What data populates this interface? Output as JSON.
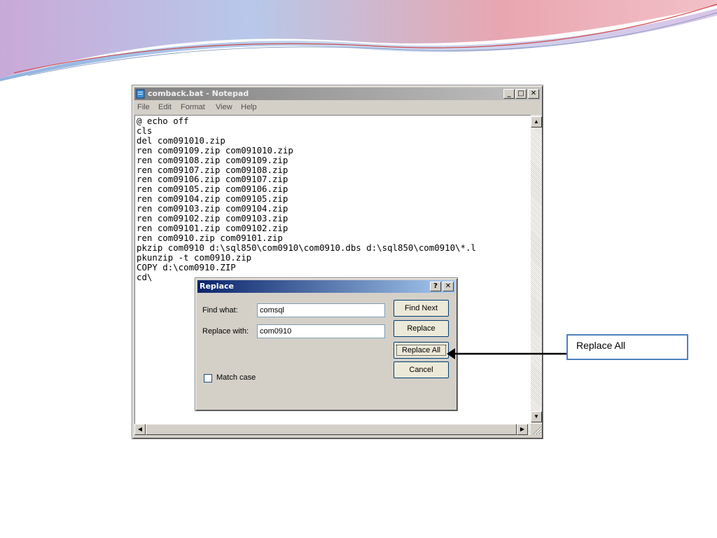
{
  "notepad": {
    "title": "comback.bat - Notepad",
    "controls": {
      "minimize": "_",
      "maximize": "□",
      "close": "✕"
    },
    "menu": [
      "File",
      "Edit",
      "Format",
      "View",
      "Help"
    ],
    "content": "@ echo off\ncls\ndel com091010.zip\nren com09109.zip com091010.zip\nren com09108.zip com09109.zip\nren com09107.zip com09108.zip\nren com09106.zip com09107.zip\nren com09105.zip com09106.zip\nren com09104.zip com09105.zip\nren com09103.zip com09104.zip\nren com09102.zip com09103.zip\nren com09101.zip com09102.zip\nren com0910.zip com09101.zip\npkzip com0910 d:\\sql850\\com0910\\com0910.dbs d:\\sql850\\com0910\\*.l\npkunzip -t com0910.zip\nCOPY d:\\com0910.ZIP\ncd\\",
    "scroll_glyphs": {
      "up": "▲",
      "down": "▼",
      "left": "◀",
      "right": "▶"
    }
  },
  "replace_dialog": {
    "title": "Replace",
    "help_button": "?",
    "close_button": "✕",
    "find_label": "Find what:",
    "find_value": "comsql",
    "replace_label": "Replace with:",
    "replace_value": "com0910",
    "buttons": {
      "find_next": "Find Next",
      "replace": "Replace",
      "replace_all": "Replace All",
      "cancel": "Cancel"
    },
    "match_case_label": "Match case",
    "match_case_checked": false
  },
  "callout": {
    "label": "Replace All"
  },
  "icons": {
    "app": "notepad-icon",
    "checkbox": "checkbox-icon",
    "grip": "size-grip-icon",
    "arrow": "callout-arrow-icon"
  }
}
